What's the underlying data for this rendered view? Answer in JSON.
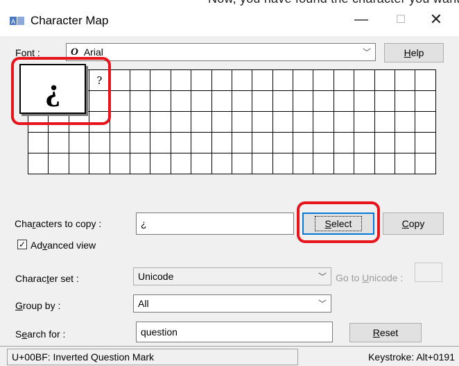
{
  "top_strip": "Now, you have found the character you want to use, s",
  "window": {
    "title": "Character Map",
    "minimize": "—",
    "maximize": "☐",
    "close": "✕"
  },
  "font": {
    "label_pre": "F",
    "label_under": "o",
    "label_post": "nt :",
    "value": "Arial",
    "icon": "opentype-font-icon"
  },
  "help_button": {
    "pre": "",
    "under": "H",
    "post": "elp"
  },
  "grid": {
    "columns": 20,
    "rows": 5,
    "cells": [
      "¿",
      "",
      "¿",
      "?",
      ""
    ]
  },
  "zoomed_char": "¿",
  "characters_to_copy": {
    "label_pre": "Cha",
    "label_under": "r",
    "label_post": "acters to copy :",
    "value": "¿"
  },
  "select_button": {
    "pre": "",
    "under": "S",
    "post": "elect"
  },
  "copy_button": {
    "pre": "",
    "under": "C",
    "post": "opy"
  },
  "advanced_view": {
    "checked": true,
    "label_pre": "Ad",
    "label_under": "v",
    "label_post": "anced view"
  },
  "character_set": {
    "label_pre": "Charac",
    "label_under": "t",
    "label_post": "er set :",
    "value": "Unicode"
  },
  "go_to_unicode": {
    "pre": "Go to ",
    "under": "U",
    "post": "nicode :"
  },
  "group_by": {
    "label_pre": "",
    "label_under": "G",
    "label_post": "roup by :",
    "value": "All"
  },
  "search_for": {
    "label_pre": "S",
    "label_under": "e",
    "label_post": "arch for :",
    "value": "question"
  },
  "reset_button": {
    "pre": "",
    "under": "R",
    "post": "eset"
  },
  "status": {
    "description": "U+00BF: Inverted Question Mark",
    "keystroke": "Keystroke: Alt+0191"
  },
  "colors": {
    "highlight": "#e8141c",
    "focus": "#0078d7",
    "dialog_bg": "#f0f0f0"
  }
}
